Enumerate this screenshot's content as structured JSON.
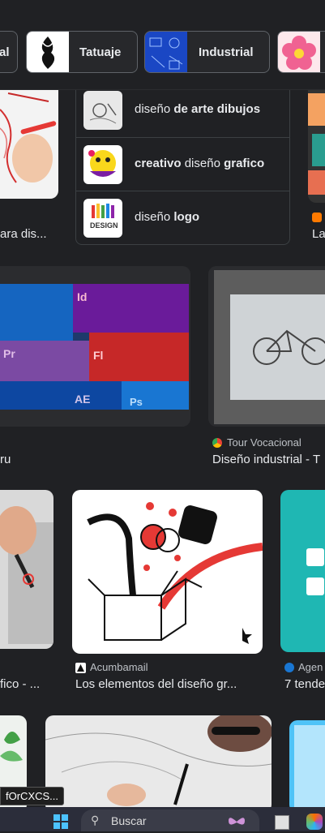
{
  "chips": [
    {
      "label": "al",
      "name": "chip-partial"
    },
    {
      "label": "Tatuaje"
    },
    {
      "label": "Industrial"
    },
    {
      "label": "",
      "name": "chip-flower"
    }
  ],
  "related_searches": [
    {
      "normal": "diseño ",
      "bold": "de arte dibujos"
    },
    {
      "bold": "creativo",
      "normal": " diseño ",
      "bold2": "grafico"
    },
    {
      "normal": "diseño ",
      "bold": "logo"
    }
  ],
  "related_icon_text": "DESIGN",
  "row1": {
    "left_title": "ara dis...",
    "right_title": "La"
  },
  "row2": {
    "left_title": "ru",
    "right_source": "Tour Vocacional",
    "right_title": "Diseño industrial - T"
  },
  "row3": {
    "left_title": "fico - ...",
    "mid_source": "Acumbamail",
    "mid_title": "Los elementos del diseño gr...",
    "right_source": "Agen",
    "right_title": "7 tende"
  },
  "adobe_labels": [
    "Id",
    "Pr",
    "Fl",
    "AE",
    "Ps"
  ],
  "tooltip": "fOrCXCS...",
  "taskbar": {
    "search_label": "Buscar"
  },
  "colors": {
    "background": "#202124",
    "text": "#e8eaed",
    "accent_red": "#e53935"
  }
}
